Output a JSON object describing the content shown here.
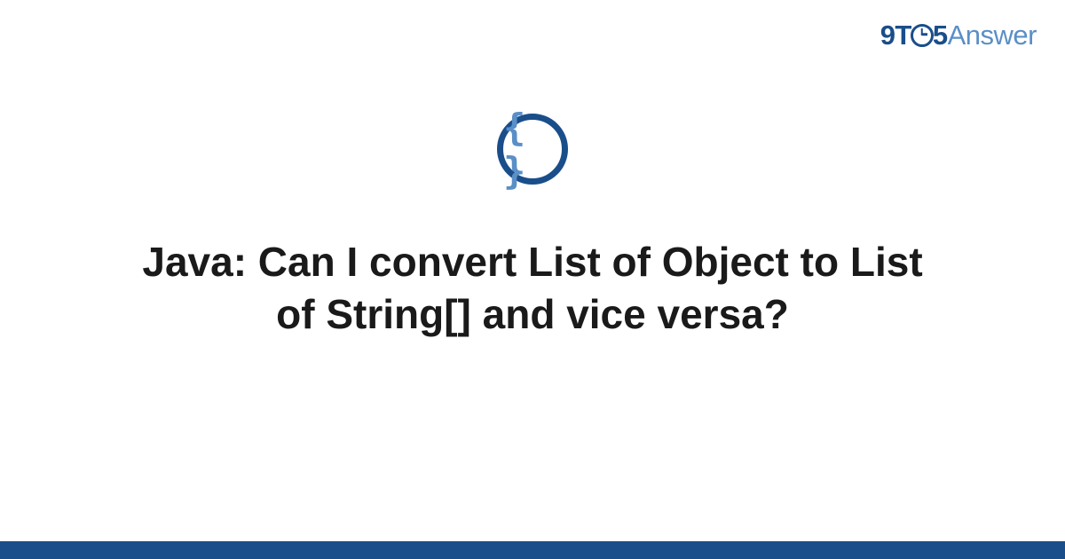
{
  "logo": {
    "part1": "9T",
    "part2": "5",
    "part3": "Answer"
  },
  "icon": {
    "name": "code-braces",
    "glyph": "{ }"
  },
  "title": "Java: Can I convert List of Object to List of String[] and vice versa?",
  "colors": {
    "primary": "#1a4e8a",
    "secondary": "#5a8fc7",
    "text": "#1a1a1a"
  }
}
